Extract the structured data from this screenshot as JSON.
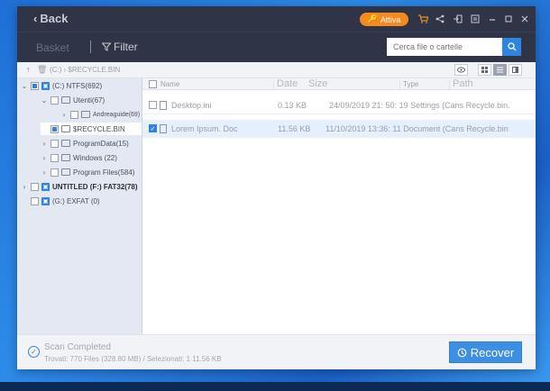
{
  "titlebar": {
    "back_label": "Back",
    "activate_label": "Attiva"
  },
  "toolbar": {
    "basket_label": "Basket",
    "filter_label": "Filter",
    "search_placeholder": "Cerca file o cartelle"
  },
  "pathbar": {
    "path": "(C:) › $RECYCLE.BIN"
  },
  "tree": {
    "items": [
      {
        "label": "(C:) NTFS(692)"
      },
      {
        "label": "Utenti(67)"
      },
      {
        "label": "Andreaguide(69)"
      },
      {
        "label": "$RECYCLE.BIN"
      },
      {
        "label": "ProgramData(15)"
      },
      {
        "label": "Windows (22)"
      },
      {
        "label": "Program Files(584)"
      },
      {
        "label": "UNTITLED (F:) FAT32(78)"
      },
      {
        "label": "(G:) EXFAT (0)"
      }
    ]
  },
  "columns": {
    "name": "Name",
    "date": "Date",
    "size": "Size",
    "type": "Type",
    "path": "Path"
  },
  "files": [
    {
      "name": "Desktop.ini",
      "size": "0.13 KB",
      "date_type": "24/09/2019 21: 50: 19 Settings (Cans Recycle.bin.",
      "selected": false
    },
    {
      "name": "Lorem Ipsum. Doc",
      "size": "11.56 KB",
      "date_type": "11/10/2019 13:36: 11 Document (Cans Recycle.bin",
      "selected": true
    }
  ],
  "footer": {
    "scan_title": "Scan Completed",
    "scan_info": "Trovati: 770 Files (328.80 MB) / Selezionati: 1 11.56 KB",
    "recover_label": "Recover"
  },
  "colors": {
    "accent": "#2f84e0",
    "titlebar": "#2f3446",
    "activate": "#f58a1f"
  }
}
